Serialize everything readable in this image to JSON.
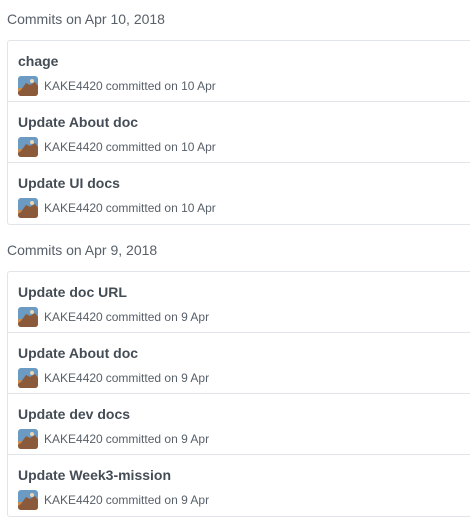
{
  "groups": [
    {
      "heading": "Commits on Apr 10, 2018",
      "commits": [
        {
          "title": "chage",
          "author": "KAKE4420",
          "meta": "committed on 10 Apr"
        },
        {
          "title": "Update About doc",
          "author": "KAKE4420",
          "meta": "committed on 10 Apr"
        },
        {
          "title": "Update UI docs",
          "author": "KAKE4420",
          "meta": "committed on 10 Apr"
        }
      ]
    },
    {
      "heading": "Commits on Apr 9, 2018",
      "commits": [
        {
          "title": "Update doc URL",
          "author": "KAKE4420",
          "meta": "committed on 9 Apr"
        },
        {
          "title": "Update About doc",
          "author": "KAKE4420",
          "meta": "committed on 9 Apr"
        },
        {
          "title": "Update dev docs",
          "author": "KAKE4420",
          "meta": "committed on 9 Apr"
        },
        {
          "title": "Update Week3-mission",
          "author": "KAKE4420",
          "meta": "committed on 9 Apr"
        }
      ]
    }
  ],
  "icons": {
    "avatar": "user-avatar-image"
  },
  "colors": {
    "border": "#e1e4e8",
    "title": "#444d56",
    "muted": "#586069"
  }
}
